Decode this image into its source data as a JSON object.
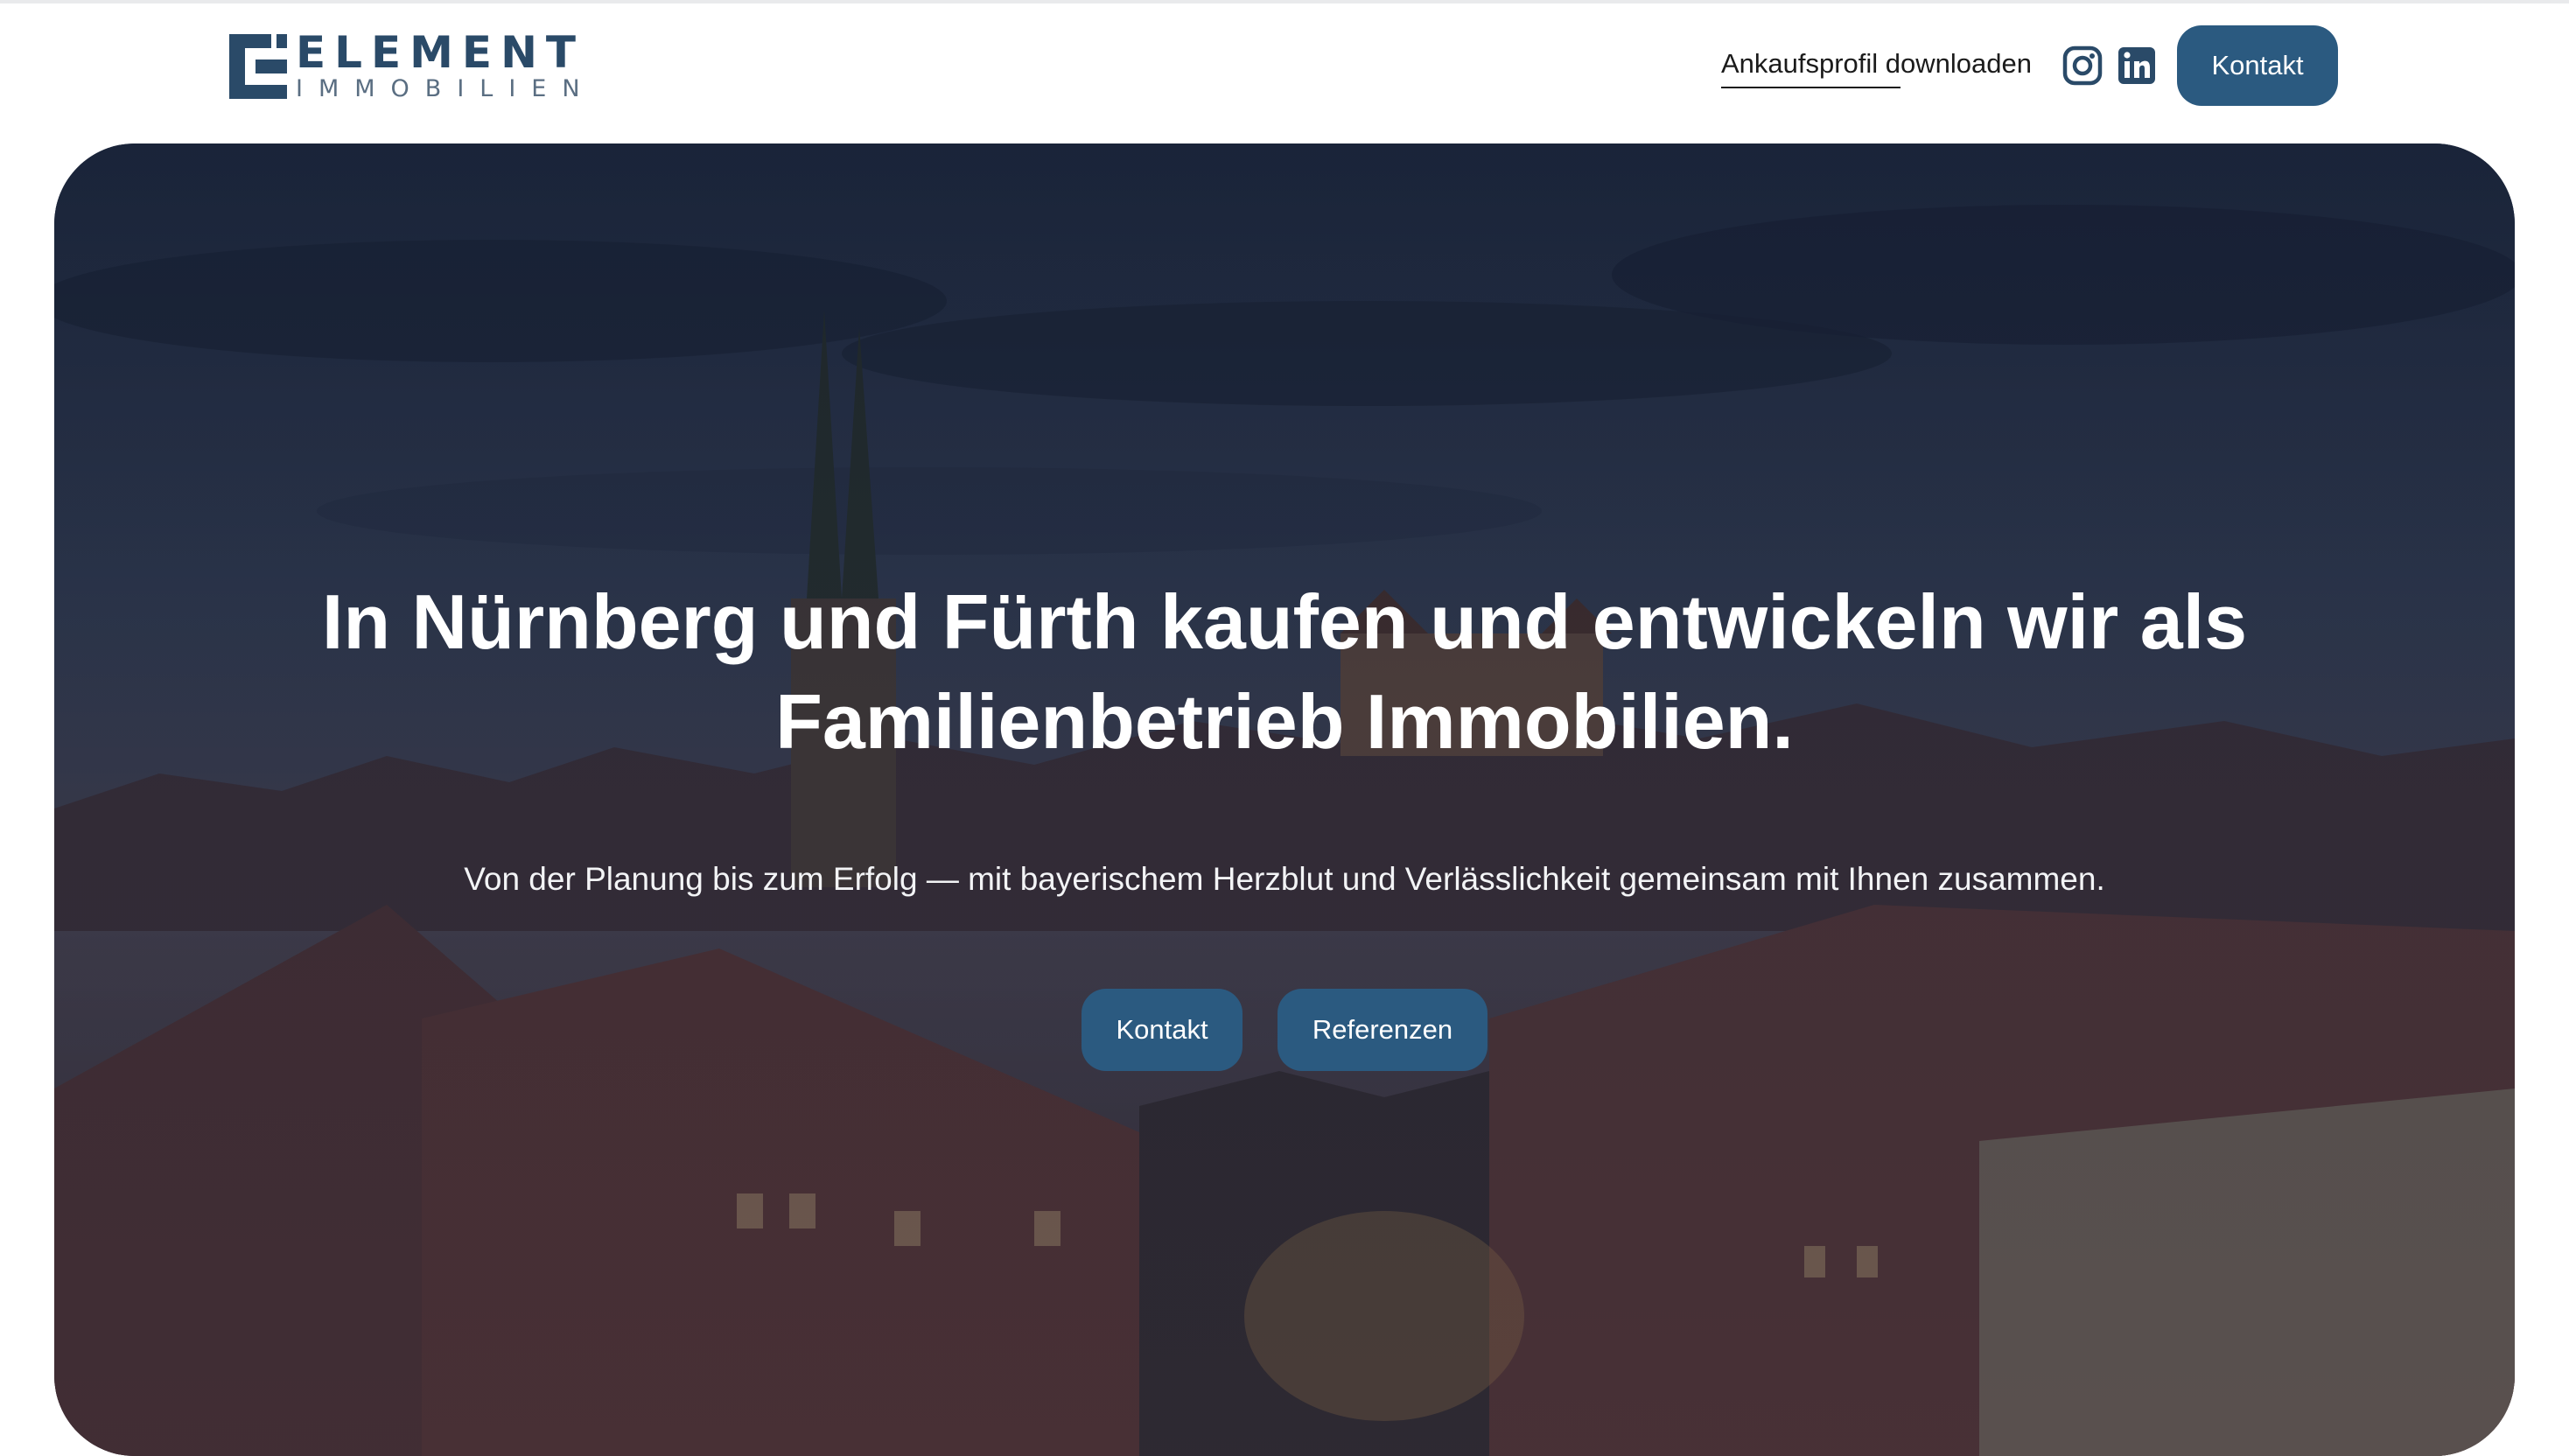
{
  "brand": {
    "name": "ELEMENT",
    "tagline": "IMMOBILIEN",
    "color": "#2a4a68"
  },
  "header": {
    "download_link": "Ankaufsprofil downloaden",
    "social": [
      {
        "icon": "instagram-icon"
      },
      {
        "icon": "linkedin-icon"
      }
    ],
    "contact_button": "Kontakt"
  },
  "hero": {
    "title_line1": "In Nürnberg und Fürth kaufen und entwickeln wir als",
    "title_line2": "Familienbetrieb Immobilien.",
    "subtitle": "Von der Planung bis zum Erfolg — mit bayerischem Herzblut und Verlässlichkeit gemeinsam mit Ihnen zusammen.",
    "buttons": {
      "primary": "Kontakt",
      "secondary": "Referenzen"
    },
    "background": "nuremberg-old-town-dusk-photo"
  },
  "colors": {
    "button": "#2b5a80",
    "text_dark": "#1b1b1b",
    "text_light": "#ffffff"
  }
}
